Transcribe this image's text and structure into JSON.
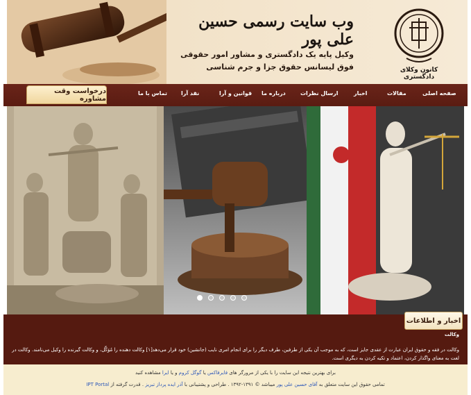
{
  "header": {
    "site_title": "وب سایت رسمی حسین علی پور",
    "line1": "وکیل پایه یک دادگستری و مشاور امور حقوقی",
    "line2": "فوق لیسانس حقوق جزا و جرم شناسی",
    "logo_caption": "کانون وکلای دادگستری"
  },
  "nav": {
    "consult_label": "درخواست وقت مشاوره",
    "items": [
      {
        "label": "صفحه اصلی"
      },
      {
        "label": "مقالات"
      },
      {
        "label": "اخبار"
      },
      {
        "label": "ارسال نظرات"
      },
      {
        "label": "درباره ما"
      },
      {
        "label": "قوانین و آرا"
      },
      {
        "label": "نقد آرا"
      },
      {
        "label": "تماس با ما"
      }
    ]
  },
  "slider": {
    "dot_count": 5,
    "active_dot": 1
  },
  "news": {
    "tab_label": "اخبار و اطلاعات",
    "subtitle": "وکالت",
    "body": "وکالت در فقه و حقوق ایران عبارت از عقدی جایز است، که به موجب آن یکی از طرفین، طرف دیگر را برای انجام امری نایب (جانشین) خود قرار می‌دهد[۱] وکالت دهنده را مُوَکِّل، و وکالت گیرنده را وکیل می‌نامند. وکالت در لغت به معنای واگذار کردن، اعتماد و تکیه کردن به دیگری است."
  },
  "footer": {
    "line1_prefix": "برای بهترین نتیجه این سایت را با یکی از مرورگر های",
    "firefox": "فایرفاکس",
    "or1": "یا",
    "chrome": "گوگل کروم",
    "or2": "و یا",
    "ie": "ایرا",
    "line1_suffix": "مشاهده کنید",
    "line2_prefix": "تمامی حقوق این سایت متعلق به",
    "owner": "آقای حسین علی پور",
    "line2_mid": "میباشد © ۱۳۹۱-۱۳۹۲ . طراحی و پشتیبانی با",
    "designer": "آذر ایده پرداز تبریز",
    "line2_mid2": ". قدرت گرفته از",
    "portal": "IPT Portal"
  },
  "colors": {
    "nav_bg": "#5a1c12",
    "news_bg": "#551a10",
    "footer_bg": "#f7edcf",
    "link": "#2b56b8"
  }
}
